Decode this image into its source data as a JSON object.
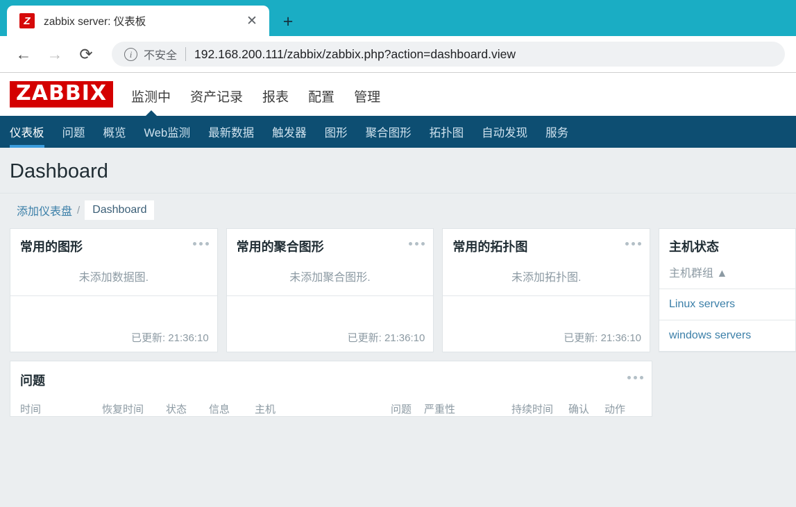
{
  "browser": {
    "tab": {
      "title": "zabbix server: 仪表板",
      "favicon_letter": "Z",
      "close_icon": "✕"
    },
    "new_tab_icon": "+",
    "back_icon": "←",
    "forward_icon": "→",
    "reload_icon": "⟳",
    "security_label": "不安全",
    "url": "192.168.200.111/zabbix/zabbix.php?action=dashboard.view",
    "tabstrip_color": "#1aadc4"
  },
  "zabbix": {
    "logo": "ZABBIX",
    "logo_color": "#d40000",
    "main_menu": [
      {
        "label": "监测中",
        "active": true
      },
      {
        "label": "资产记录",
        "active": false
      },
      {
        "label": "报表",
        "active": false
      },
      {
        "label": "配置",
        "active": false
      },
      {
        "label": "管理",
        "active": false
      }
    ],
    "sub_menu": [
      {
        "label": "仪表板",
        "active": true
      },
      {
        "label": "问题",
        "active": false
      },
      {
        "label": "概览",
        "active": false
      },
      {
        "label": "Web监测",
        "active": false
      },
      {
        "label": "最新数据",
        "active": false
      },
      {
        "label": "触发器",
        "active": false
      },
      {
        "label": "图形",
        "active": false
      },
      {
        "label": "聚合图形",
        "active": false
      },
      {
        "label": "拓扑图",
        "active": false
      },
      {
        "label": "自动发现",
        "active": false
      },
      {
        "label": "服务",
        "active": false
      }
    ],
    "nav_color": "#0d4e72",
    "accent_color": "#3b9ddd"
  },
  "page": {
    "title": "Dashboard",
    "breadcrumb": {
      "link": "添加仪表盘",
      "separator": "/",
      "current": "Dashboard"
    }
  },
  "widgets": {
    "graphs": {
      "title": "常用的图形",
      "empty": "未添加数据图.",
      "updated": "已更新: 21:36:10"
    },
    "screens": {
      "title": "常用的聚合图形",
      "empty": "未添加聚合图形.",
      "updated": "已更新: 21:36:10"
    },
    "maps": {
      "title": "常用的拓扑图",
      "empty": "未添加拓扑图.",
      "updated": "已更新: 21:36:10"
    },
    "hosts": {
      "title": "主机状态",
      "column_header": "主机群组",
      "sort_indicator": "▲",
      "rows": [
        "Linux servers",
        "windows servers"
      ]
    },
    "problems": {
      "title": "问题",
      "columns": [
        "时间",
        "恢复时间",
        "状态",
        "信息",
        "主机",
        "问题",
        "严重性",
        "持续时间",
        "确认",
        "动作"
      ]
    }
  }
}
